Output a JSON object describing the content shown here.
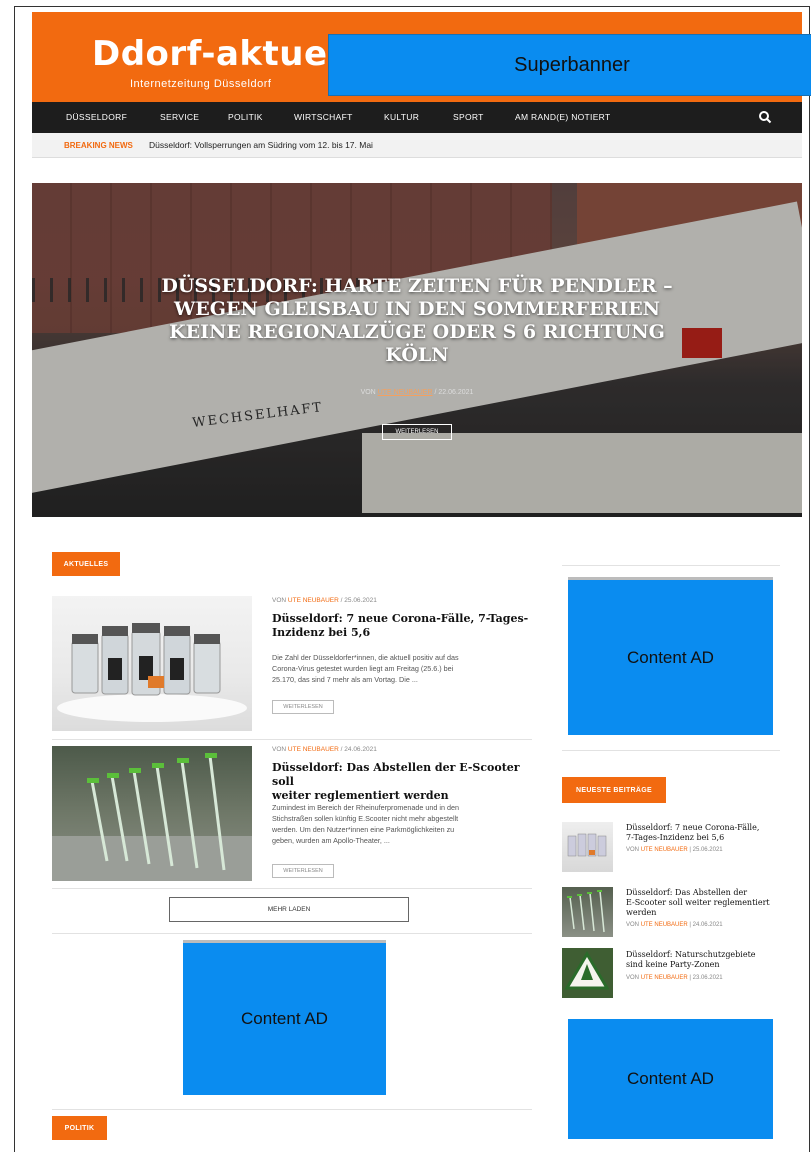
{
  "header": {
    "logo": "Ddorf-aktuell",
    "logo_sub": "Internetzeitung Düsseldorf",
    "superbanner": "Superbanner",
    "accent_color": "#f26a10"
  },
  "nav": {
    "items": [
      "DÜSSELDORF",
      "SERVICE",
      "POLITIK",
      "WIRTSCHAFT",
      "KULTUR",
      "SPORT",
      "AM RAND(E) NOTIERT"
    ],
    "search_icon": "search-icon"
  },
  "breaking": {
    "label": "BREAKING NEWS",
    "text": "Düsseldorf: Vollsperrungen am Südring vom 12. bis 17. Mai"
  },
  "hero": {
    "title_lines": [
      "DÜSSELDORF: HARTE ZEITEN FÜR PENDLER –",
      "WEGEN GLEISBAU IN DEN SOMMERFERIEN",
      "KEINE REGIONALZÜGE ODER S 6 RICHTUNG",
      "KÖLN"
    ],
    "meta_prefix": "VON",
    "author": "UTE NEUBAUER",
    "date": "22.06.2021",
    "button": "WEITERLESEN",
    "sign_text": "WECHSELHAFT"
  },
  "sections": {
    "aktuelles": "AKTUELLES",
    "politik": "POLITIK",
    "neueste": "NEUESTE BEITRÄGE"
  },
  "articles": [
    {
      "meta_prefix": "VON",
      "author": "UTE NEUBAUER",
      "date": "25.06.2021",
      "title_lines": [
        "Düsseldorf: 7 neue Corona-Fälle, 7-Tages-",
        "Inzidenz bei 5,6"
      ],
      "excerpt_lines": [
        "Die Zahl der Düsseldorfer*innen, die aktuell positiv auf das",
        "Corona-Virus getestet wurden liegt am Freitag (25.6.) bei",
        "25.170, das sind 7 mehr als am Vortag. Die ..."
      ],
      "button": "WEITERLESEN"
    },
    {
      "meta_prefix": "VON",
      "author": "UTE NEUBAUER",
      "date": "24.06.2021",
      "title_lines": [
        "Düsseldorf: Das Abstellen der E-Scooter soll",
        "weiter reglementiert werden"
      ],
      "excerpt_lines": [
        "Zumindest im Bereich der Rheinuferpromenade und in den",
        "Stichstraßen sollen künftig E.Scooter nicht mehr abgestellt",
        "werden. Um den Nutzer*innen eine Parkmöglichkeiten zu",
        "geben, wurden am Apollo-Theater, ..."
      ],
      "button": "WEITERLESEN"
    }
  ],
  "mehr_laden": "MEHR LADEN",
  "ads": {
    "content_ad_1": "Content AD",
    "content_ad_2": "Content AD",
    "content_ad_3": "Content AD"
  },
  "sidebar_posts": [
    {
      "title_lines": [
        "Düsseldorf: 7 neue Corona-Fälle,",
        "7-Tages-Inzidenz bei 5,6"
      ],
      "meta_prefix": "VON",
      "author": "UTE NEUBAUER",
      "date": "25.06.2021"
    },
    {
      "title_lines": [
        "Düsseldorf: Das Abstellen der",
        "E-Scooter soll weiter reglementiert",
        "werden"
      ],
      "meta_prefix": "VON",
      "author": "UTE NEUBAUER",
      "date": "24.06.2021"
    },
    {
      "title_lines": [
        "Düsseldorf: Naturschutzgebiete",
        "sind keine Party-Zonen"
      ],
      "meta_prefix": "VON",
      "author": "UTE NEUBAUER",
      "date": "23.06.2021"
    }
  ]
}
